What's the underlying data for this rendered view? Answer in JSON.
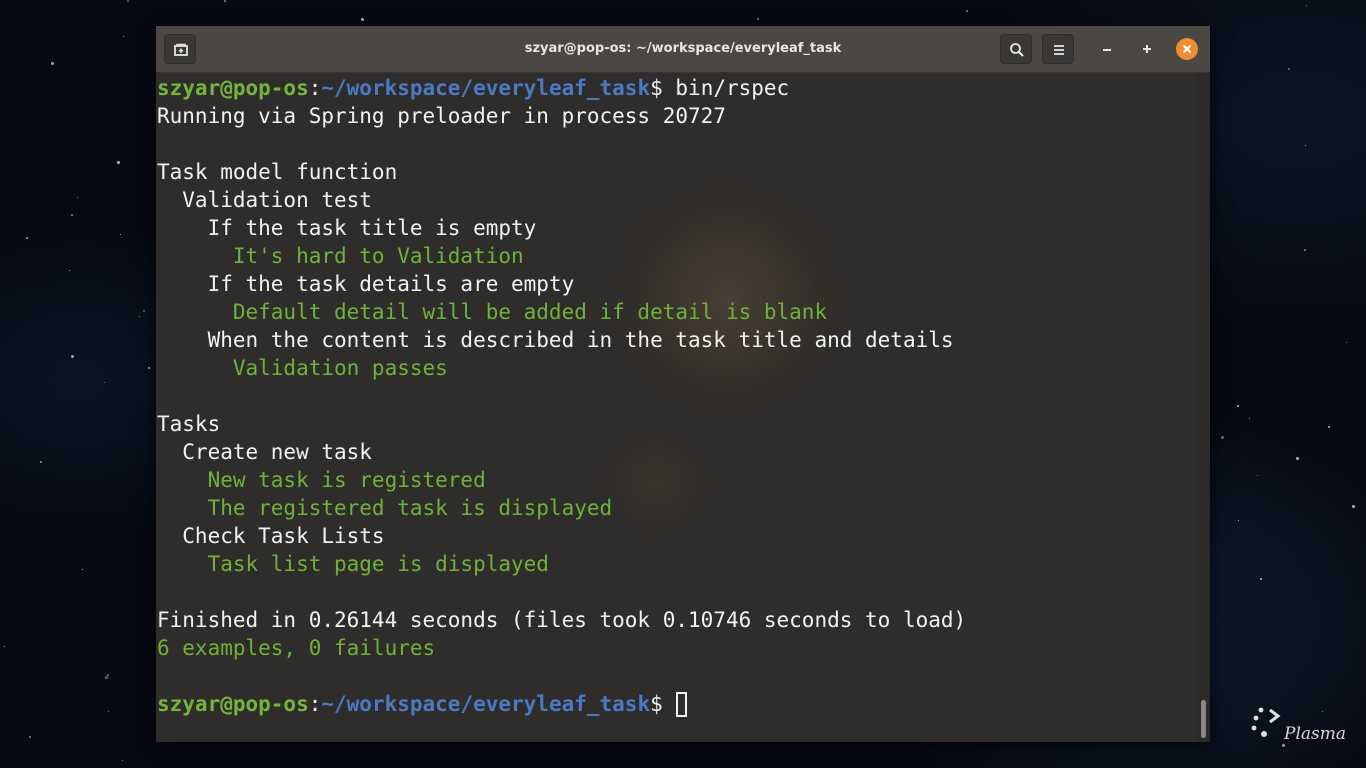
{
  "window": {
    "title": "szyar@pop-os: ~/workspace/everyleaf_task"
  },
  "terminal": {
    "prompt_user": "szyar@pop-os",
    "prompt_sep": ":",
    "prompt_path": "~/workspace/everyleaf_task",
    "prompt_symbol": "$",
    "command": " bin/rspec",
    "lines": [
      {
        "text": "Running via Spring preloader in process 20727",
        "color": "white"
      },
      {
        "text": "",
        "color": "white"
      },
      {
        "text": "Task model function",
        "color": "white"
      },
      {
        "text": "  Validation test",
        "color": "white"
      },
      {
        "text": "    If the task title is empty",
        "color": "white"
      },
      {
        "text": "      It's hard to Validation",
        "color": "green"
      },
      {
        "text": "    If the task details are empty",
        "color": "white"
      },
      {
        "text": "      Default detail will be added if detail is blank",
        "color": "green"
      },
      {
        "text": "    When the content is described in the task title and details",
        "color": "white"
      },
      {
        "text": "      Validation passes",
        "color": "green"
      },
      {
        "text": "",
        "color": "white"
      },
      {
        "text": "Tasks",
        "color": "white"
      },
      {
        "text": "  Create new task",
        "color": "white"
      },
      {
        "text": "    New task is registered",
        "color": "green"
      },
      {
        "text": "    The registered task is displayed",
        "color": "green"
      },
      {
        "text": "  Check Task Lists",
        "color": "white"
      },
      {
        "text": "    Task list page is displayed",
        "color": "green"
      },
      {
        "text": "",
        "color": "white"
      },
      {
        "text": "Finished in 0.26144 seconds (files took 0.10746 seconds to load)",
        "color": "white"
      },
      {
        "text": "6 examples, 0 failures",
        "color": "green"
      },
      {
        "text": "",
        "color": "white"
      }
    ]
  },
  "desktop": {
    "branding": "Plasma"
  },
  "icons": {
    "new_tab": "new-tab-icon",
    "search": "search-icon",
    "menu": "hamburger-menu-icon",
    "minimize": "minimize-icon",
    "maximize": "maximize-icon",
    "close": "close-icon"
  },
  "colors": {
    "titlebar": "#4a4745",
    "terminal_bg": "#2f2d2b",
    "green": "#6fb23a",
    "path_blue": "#4b7ac2",
    "close_orange": "#f28c30"
  }
}
